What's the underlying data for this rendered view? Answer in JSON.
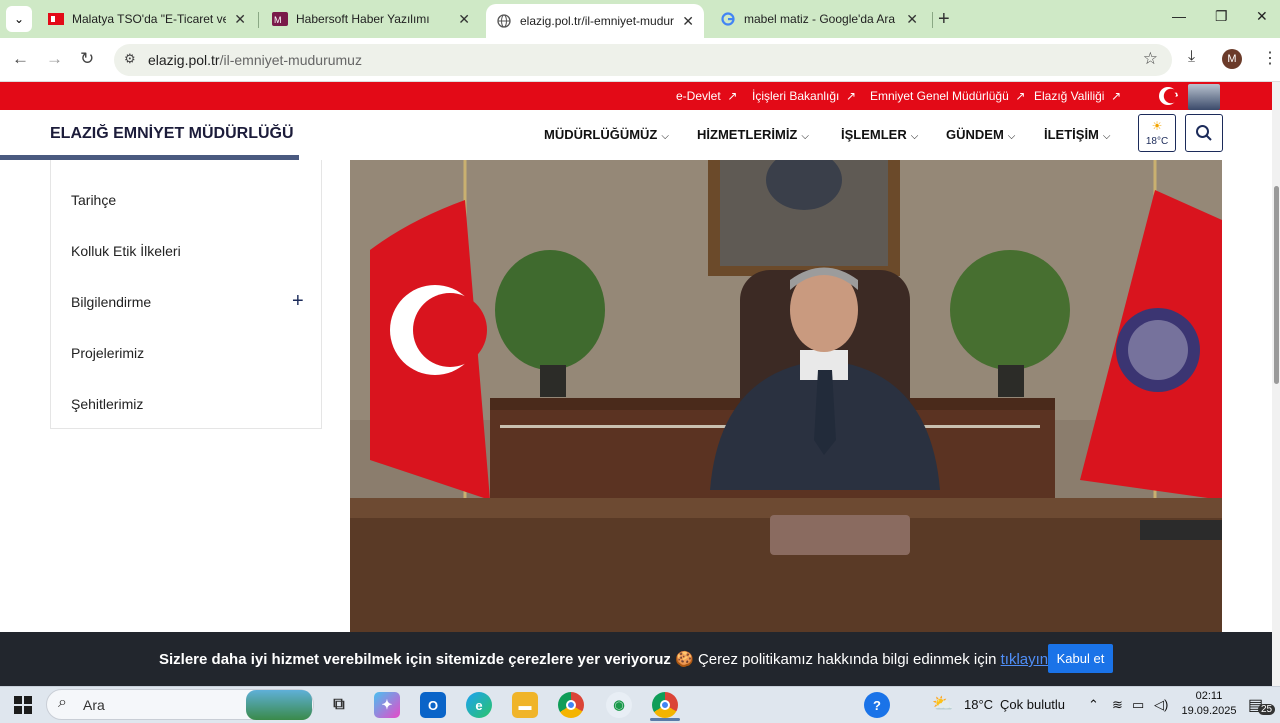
{
  "browser": {
    "tabs": [
      {
        "title": "Malatya TSO'da \"E-Ticaret ve Yapay",
        "active": false
      },
      {
        "title": "Habersoft Haber Yazılımı",
        "active": false
      },
      {
        "title": "elazig.pol.tr/il-emniyet-mudurumuz",
        "active": true
      },
      {
        "title": "mabel matiz - Google'da Ara",
        "active": false
      }
    ],
    "url_host": "elazig.pol.tr",
    "url_path": "/il-emniyet-mudurumuz",
    "profile_initial": "M"
  },
  "site": {
    "top_links": [
      "e-Devlet",
      "İçişleri Bakanlığı",
      "Emniyet Genel Müdürlüğü",
      "Elazığ Valiliği"
    ],
    "title": "ELAZIĞ EMNİYET MÜDÜRLÜĞÜ",
    "menu": [
      "MÜDÜRLÜĞÜMÜZ",
      "HİZMETLERİMİZ",
      "İŞLEMLER",
      "GÜNDEM",
      "İLETİŞİM"
    ],
    "weather_temp": "18°C",
    "side_menu": [
      "Tarihçe",
      "Kolluk Etik İlkeleri",
      "Bilgilendirme",
      "Projelerimiz",
      "Şehitlerimiz"
    ]
  },
  "cookie": {
    "bold_text": "Sizlere daha iyi hizmet verebilmek için sitemizde çerezlere yer veriyoruz",
    "text": "Çerez politikamız hakkında bilgi edinmek için",
    "link": "tıklayınız",
    "button": "Kabul et"
  },
  "taskbar": {
    "search_placeholder": "Ara",
    "weather": "18°C",
    "weather_desc": "Çok bulutlu",
    "time": "02:11",
    "date": "19.09.2025",
    "notification_count": "25"
  },
  "colors": {
    "red": "#e30a17",
    "navy": "#1c2b5a",
    "tabstrip": "#cfe9c6",
    "cookie_bg": "#22262d",
    "accept": "#1a73e8"
  }
}
